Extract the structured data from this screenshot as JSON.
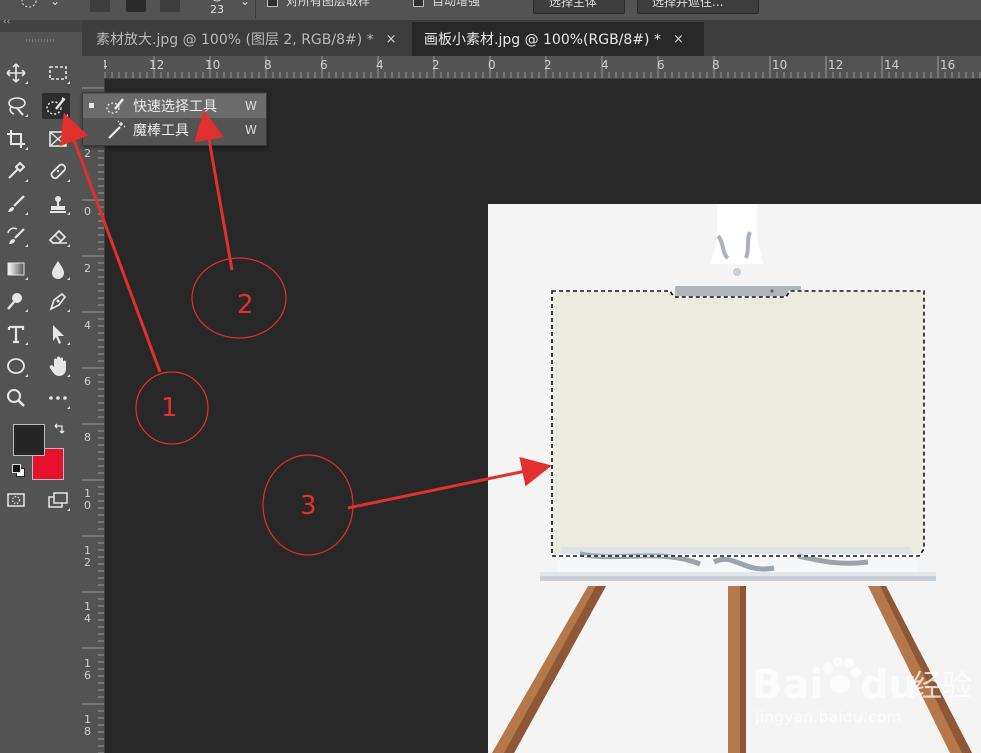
{
  "options_bar": {
    "brush_size": "23",
    "sample_all_layers_label": "对所有图层取样",
    "auto_enhance_label": "自动增强",
    "select_subject_label": "选择主体",
    "select_and_mask_label": "选择并遮住..."
  },
  "tabs": [
    {
      "title": "素材放大.jpg @ 100% (图层 2, RGB/8#) *",
      "close": "×"
    },
    {
      "title": "画板小素材.jpg @ 100%(RGB/8#) *",
      "close": "×"
    }
  ],
  "ruler": {
    "horizontal": [
      "4",
      "12",
      "10",
      "8",
      "6",
      "4",
      "2",
      "0",
      "2",
      "4",
      "6",
      "8",
      "10",
      "12",
      "14",
      "16"
    ],
    "vertical": [
      "2",
      "0",
      "2",
      "4",
      "6",
      "8",
      "1\n0",
      "1\n2",
      "1\n4",
      "1\n6",
      "1\n8"
    ]
  },
  "flyout": {
    "items": [
      {
        "label": "快速选择工具",
        "shortcut": "W",
        "selected": true
      },
      {
        "label": "魔棒工具",
        "shortcut": "W",
        "selected": false
      }
    ]
  },
  "colors": {
    "foreground": "#262626",
    "background": "#e8112d",
    "annotation": "#e2302e",
    "panel": "#535353",
    "workspace": "#282828"
  },
  "annotations": [
    "1",
    "2",
    "3"
  ],
  "watermark": {
    "brand": "Baidu 经验",
    "url": "jingyan.baidu.com"
  },
  "icons": [
    "move-icon",
    "marquee-icon",
    "lasso-icon",
    "quick-selection-icon",
    "crop-icon",
    "frame-icon",
    "eyedropper-icon",
    "healing-brush-icon",
    "brush-icon",
    "stamp-icon",
    "history-brush-icon",
    "eraser-icon",
    "gradient-icon",
    "blur-icon",
    "dodge-icon",
    "pen-icon",
    "type-icon",
    "path-selection-icon",
    "ellipse-icon",
    "hand-icon",
    "zoom-icon",
    "more-icon",
    "quick-mask-icon",
    "screen-mode-icon"
  ]
}
